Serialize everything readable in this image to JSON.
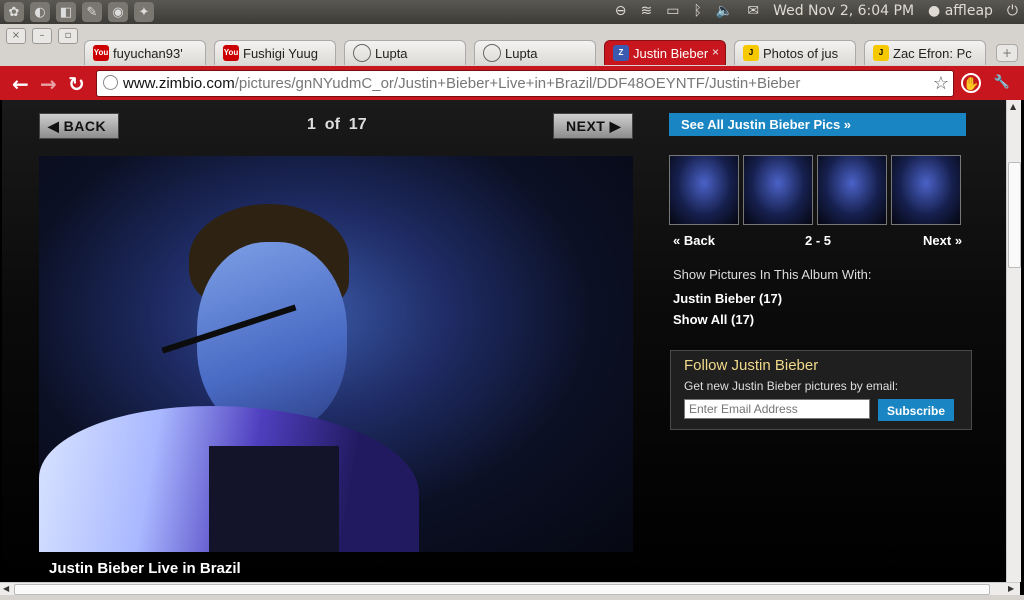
{
  "panel": {
    "datetime": "Wed Nov  2,  6:04 PM",
    "user": "affleap"
  },
  "tabs": [
    {
      "title": "fuyuchan93'",
      "favicon": "youtube"
    },
    {
      "title": "Fushigi Yuug",
      "favicon": "youtube"
    },
    {
      "title": "Lupta",
      "favicon": "globe"
    },
    {
      "title": "Lupta",
      "favicon": "globe"
    },
    {
      "title": "Justin Bieber",
      "favicon": "zimbio",
      "active": true
    },
    {
      "title": "Photos of jus",
      "favicon": "j"
    },
    {
      "title": "Zac Efron: Pc",
      "favicon": "j"
    }
  ],
  "omnibox": {
    "domain": "www.zimbio.com",
    "path": "/pictures/gnNYudmC_or/Justin+Bieber+Live+in+Brazil/DDF48OEYNTF/Justin+Bieber"
  },
  "gallery": {
    "back_label": "BACK",
    "next_label": "NEXT",
    "current": "1",
    "of_label": "of",
    "total": "17",
    "caption": "Justin Bieber Live in Brazil"
  },
  "sidebar": {
    "see_all": "See All Justin Bieber Pics »",
    "thumbs_back": "Back",
    "thumbs_range": "2 - 5",
    "thumbs_next": "Next",
    "show_pictures_label": "Show Pictures In This Album With:",
    "filter_person": "Justin Bieber (17)",
    "filter_all": "Show All (17)"
  },
  "follow": {
    "title": "Follow Justin Bieber",
    "subtitle": "Get new Justin Bieber pictures by email:",
    "email_placeholder": "Enter Email Address",
    "subscribe_label": "Subscribe"
  },
  "colors": {
    "chrome_red": "#c8161e",
    "zimbio_blue": "#1985c2",
    "follow_title": "#f1d98a"
  }
}
